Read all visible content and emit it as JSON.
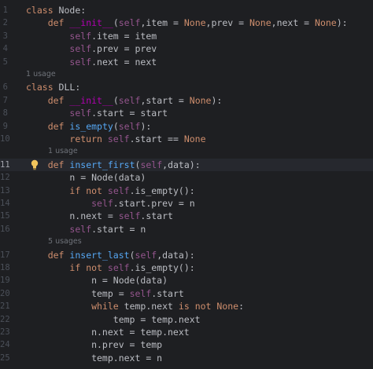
{
  "lines": [
    {
      "n": "1",
      "text": "class Node:"
    },
    {
      "n": "2",
      "text": "    def __init__(self,item = None,prev = None,next = None):"
    },
    {
      "n": "3",
      "text": "        self.item = item"
    },
    {
      "n": "4",
      "text": "        self.prev = prev"
    },
    {
      "n": "5",
      "text": "        self.next = next"
    },
    {
      "hint": "1 usage",
      "indent": 0
    },
    {
      "n": "6",
      "text": "class DLL:"
    },
    {
      "n": "7",
      "text": "    def __init__(self,start = None):"
    },
    {
      "n": "8",
      "text": "        self.start = start"
    },
    {
      "n": "9",
      "text": "    def is_empty(self):"
    },
    {
      "n": "10",
      "text": "        return self.start == None"
    },
    {
      "hint": "1 usage",
      "indent": 4
    },
    {
      "n": "11",
      "text": "    def insert_first(self,data):",
      "current": true
    },
    {
      "n": "12",
      "text": "        n = Node(data)"
    },
    {
      "n": "13",
      "text": "        if not self.is_empty():"
    },
    {
      "n": "14",
      "text": "            self.start.prev = n"
    },
    {
      "n": "15",
      "text": "        n.next = self.start"
    },
    {
      "n": "16",
      "text": "        self.start = n"
    },
    {
      "hint": "5 usages",
      "indent": 4
    },
    {
      "n": "17",
      "text": "    def insert_last(self,data):"
    },
    {
      "n": "18",
      "text": "        if not self.is_empty():"
    },
    {
      "n": "19",
      "text": "            n = Node(data)"
    },
    {
      "n": "20",
      "text": "            temp = self.start"
    },
    {
      "n": "21",
      "text": "            while temp.next is not None:"
    },
    {
      "n": "22",
      "text": "                temp = temp.next"
    },
    {
      "n": "23",
      "text": "            n.next = temp.next"
    },
    {
      "n": "24",
      "text": "            n.prev = temp"
    },
    {
      "n": "25",
      "text": "            temp.next = n"
    }
  ],
  "colors": {
    "background": "#1e1f22",
    "current_line": "#26282e",
    "keyword": "#cf8e6d",
    "function": "#56a8f5",
    "self": "#94558d",
    "dunder": "#b200b2",
    "text": "#bcbec4",
    "line_number": "#4b5059",
    "hint": "#6f737a"
  },
  "icons": {
    "intention_bulb": "lightbulb-icon"
  }
}
